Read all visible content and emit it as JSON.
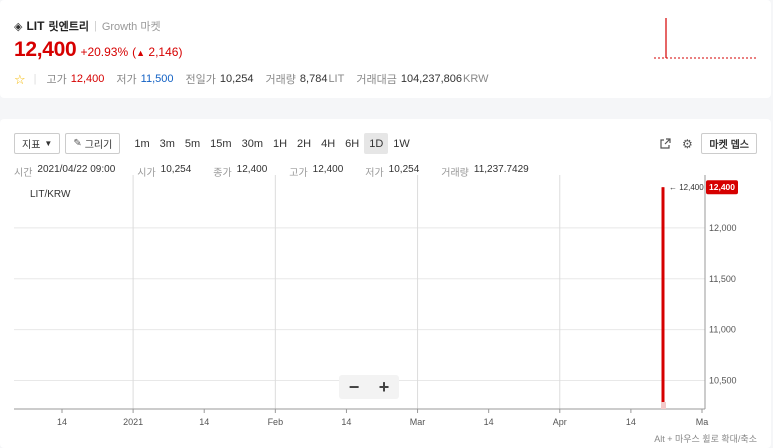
{
  "ticker": {
    "diamond": "◈",
    "symbol": "LIT",
    "name": "릿엔트리",
    "market": "Growth 마켓",
    "price": "12,400",
    "change_pct": "+20.93%",
    "change_abs": "2,146",
    "stats": {
      "high_label": "고가",
      "high": "12,400",
      "low_label": "저가",
      "low": "11,500",
      "prev_label": "전일가",
      "prev": "10,254",
      "vol_label": "거래량",
      "vol": "8,784",
      "vol_unit": "LIT",
      "amt_label": "거래대금",
      "amt": "104,237,806",
      "amt_unit": "KRW"
    }
  },
  "toolbar": {
    "indicator_label": "지표",
    "draw_label": "그리기",
    "intervals": [
      "1m",
      "3m",
      "5m",
      "15m",
      "30m",
      "1H",
      "2H",
      "4H",
      "6H",
      "1D",
      "1W"
    ],
    "active_interval": "1D",
    "depth_label": "마켓 뎁스"
  },
  "ohlc": {
    "time_label": "시간",
    "time": "2021/04/22 09:00",
    "open_label": "시가",
    "open": "10,254",
    "close_label": "종가",
    "close": "12,400",
    "high_label": "고가",
    "high": "12,400",
    "low_label": "저가",
    "low": "10,254",
    "vol_label": "거래량",
    "vol": "11,237.7429"
  },
  "chart_data": {
    "type": "line",
    "pair_label": "LIT/KRW",
    "x_ticks": [
      "14",
      "2021",
      "14",
      "Feb",
      "14",
      "Mar",
      "14",
      "Apr",
      "14",
      "Ma"
    ],
    "y_ticks": [
      "12,000",
      "11,500",
      "11,000",
      "10,500"
    ],
    "y_tick_values": [
      12000,
      11500,
      11000,
      10500
    ],
    "ylim": [
      10220,
      12520
    ],
    "last_price": 12400,
    "last_price_label": "12,400",
    "candle": {
      "date": "2021/04/22",
      "open": 10254,
      "high": 12400,
      "low": 10254,
      "close": 12400
    },
    "grid": true,
    "colors": {
      "up": "#d60000",
      "grid": "#e8e8e8",
      "axis": "#999999"
    }
  },
  "hint": "Alt + 마우스 휠로 확대/축소",
  "zoom": {
    "minus": "−",
    "plus": "+"
  }
}
